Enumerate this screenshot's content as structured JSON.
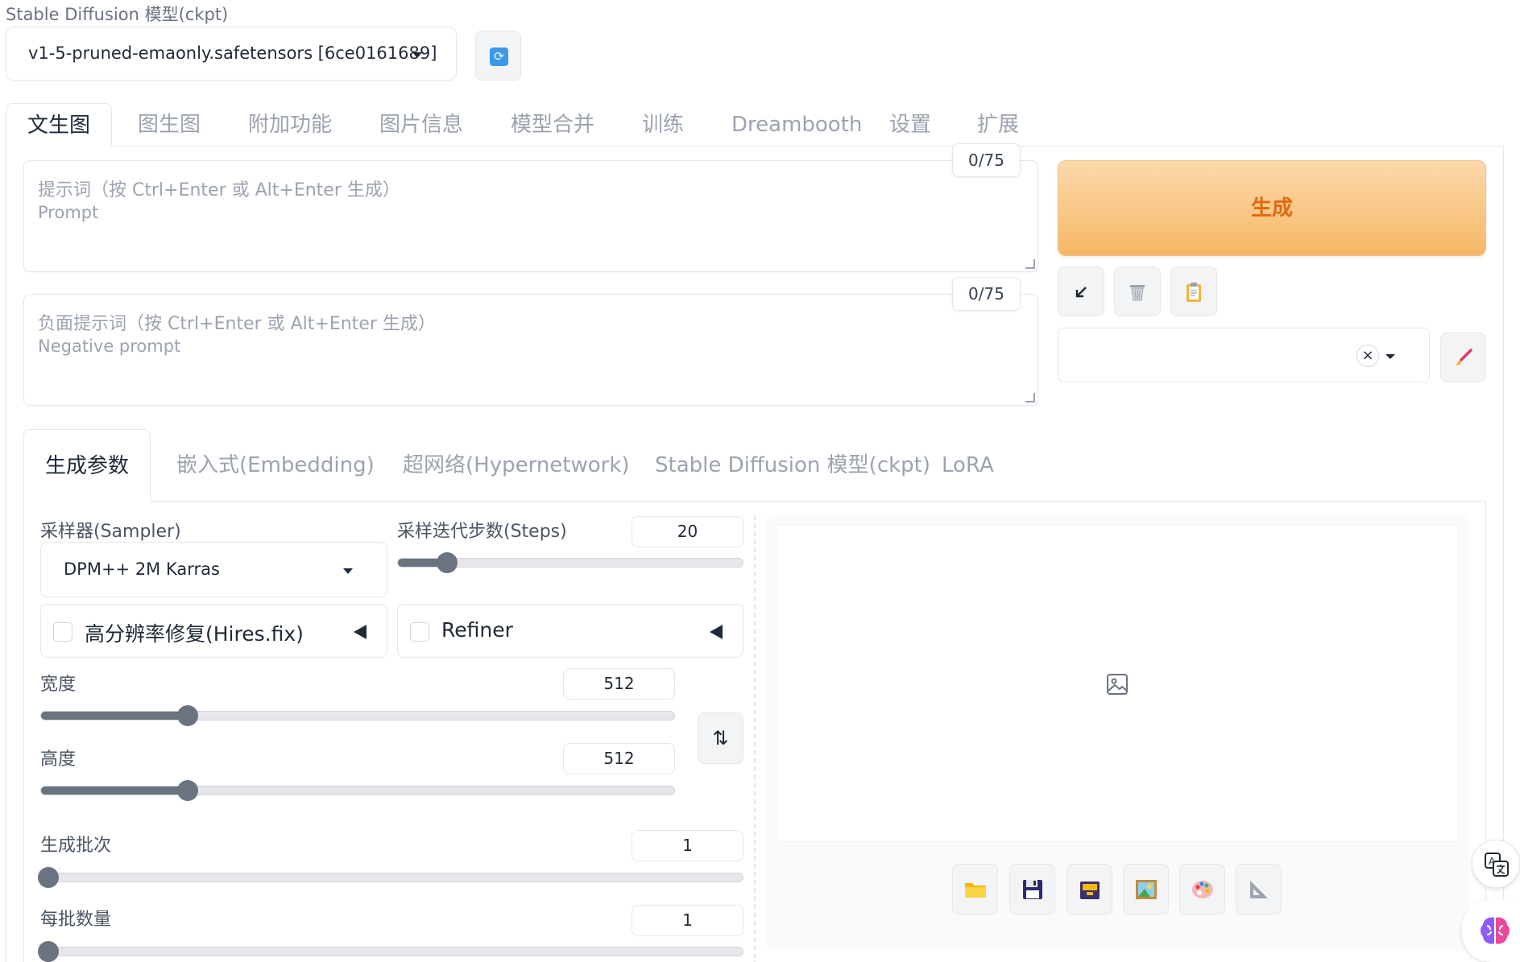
{
  "model": {
    "label": "Stable Diffusion 模型(ckpt)",
    "selected": "v1-5-pruned-emaonly.safetensors [6ce0161689]"
  },
  "main_tabs": [
    {
      "label": "文生图",
      "active": true
    },
    {
      "label": "图生图"
    },
    {
      "label": "附加功能"
    },
    {
      "label": "图片信息"
    },
    {
      "label": "模型合并"
    },
    {
      "label": "训练"
    },
    {
      "label": "Dreambooth"
    },
    {
      "label": "设置"
    },
    {
      "label": "扩展"
    }
  ],
  "prompt": {
    "placeholder_line1": "提示词（按 Ctrl+Enter 或 Alt+Enter 生成）",
    "placeholder_line2": "Prompt",
    "token_count": "0/75"
  },
  "negative_prompt": {
    "placeholder_line1": "负面提示词（按 Ctrl+Enter 或 Alt+Enter 生成）",
    "placeholder_line2": "Negative prompt",
    "token_count": "0/75"
  },
  "generate_label": "生成",
  "tool_icons": [
    "arrow-down-left-icon",
    "trash-icon",
    "clipboard-icon"
  ],
  "style_select": {
    "clear": "×"
  },
  "sub_tabs": [
    {
      "label": "生成参数",
      "active": true
    },
    {
      "label": "嵌入式(Embedding)"
    },
    {
      "label": "超网络(Hypernetwork)"
    },
    {
      "label": "Stable Diffusion 模型(ckpt)"
    },
    {
      "label": "LoRA"
    }
  ],
  "sampler": {
    "label": "采样器(Sampler)",
    "selected": "DPM++ 2M Karras"
  },
  "steps": {
    "label": "采样迭代步数(Steps)",
    "value": "20",
    "min": 1,
    "max": 150
  },
  "hires_fix": {
    "label": "高分辨率修复(Hires.fix)",
    "checked": false
  },
  "refiner": {
    "label": "Refiner",
    "checked": false
  },
  "width": {
    "label": "宽度",
    "value": "512",
    "min": 64,
    "max": 2048
  },
  "height": {
    "label": "高度",
    "value": "512",
    "min": 64,
    "max": 2048
  },
  "batch_count": {
    "label": "生成批次",
    "value": "1",
    "min": 1,
    "max": 100
  },
  "batch_size": {
    "label": "每批数量",
    "value": "1",
    "min": 1,
    "max": 8
  },
  "swap_icon": "⇅",
  "output_buttons": [
    "folder-icon",
    "save-icon",
    "zip-icon",
    "image-icon",
    "palette-icon",
    "ruler-icon"
  ],
  "colors": {
    "generate_bg": "#f6b765",
    "generate_text": "#e06a10",
    "accent_blue": "#3b9ae8",
    "slider_fill": "#6b7280"
  }
}
